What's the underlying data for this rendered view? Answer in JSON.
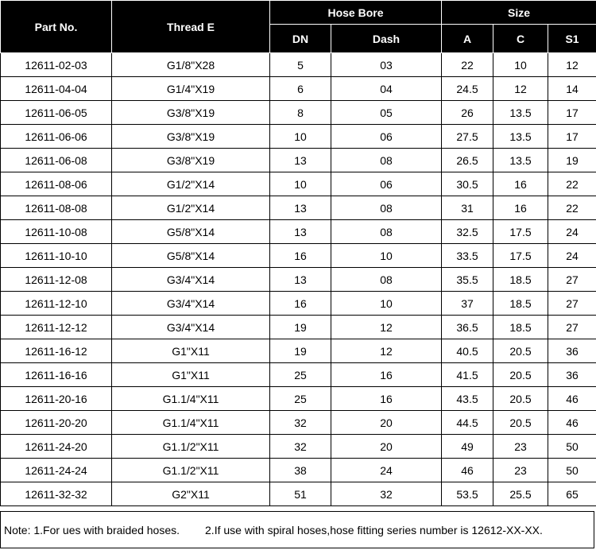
{
  "headers": {
    "part_no": "Part No.",
    "thread": "Thread E",
    "hose_bore": "Hose Bore",
    "size": "Size",
    "dn": "DN",
    "dash": "Dash",
    "a": "A",
    "c": "C",
    "s1": "S1"
  },
  "rows": [
    [
      "12611-02-03",
      "G1/8\"X28",
      "5",
      "03",
      "22",
      "10",
      "12"
    ],
    [
      "12611-04-04",
      "G1/4\"X19",
      "6",
      "04",
      "24.5",
      "12",
      "14"
    ],
    [
      "12611-06-05",
      "G3/8\"X19",
      "8",
      "05",
      "26",
      "13.5",
      "17"
    ],
    [
      "12611-06-06",
      "G3/8\"X19",
      "10",
      "06",
      "27.5",
      "13.5",
      "17"
    ],
    [
      "12611-06-08",
      "G3/8\"X19",
      "13",
      "08",
      "26.5",
      "13.5",
      "19"
    ],
    [
      "12611-08-06",
      "G1/2\"X14",
      "10",
      "06",
      "30.5",
      "16",
      "22"
    ],
    [
      "12611-08-08",
      "G1/2\"X14",
      "13",
      "08",
      "31",
      "16",
      "22"
    ],
    [
      "12611-10-08",
      "G5/8\"X14",
      "13",
      "08",
      "32.5",
      "17.5",
      "24"
    ],
    [
      "12611-10-10",
      "G5/8\"X14",
      "16",
      "10",
      "33.5",
      "17.5",
      "24"
    ],
    [
      "12611-12-08",
      "G3/4\"X14",
      "13",
      "08",
      "35.5",
      "18.5",
      "27"
    ],
    [
      "12611-12-10",
      "G3/4\"X14",
      "16",
      "10",
      "37",
      "18.5",
      "27"
    ],
    [
      "12611-12-12",
      "G3/4\"X14",
      "19",
      "12",
      "36.5",
      "18.5",
      "27"
    ],
    [
      "12611-16-12",
      "G1\"X11",
      "19",
      "12",
      "40.5",
      "20.5",
      "36"
    ],
    [
      "12611-16-16",
      "G1\"X11",
      "25",
      "16",
      "41.5",
      "20.5",
      "36"
    ],
    [
      "12611-20-16",
      "G1.1/4\"X11",
      "25",
      "16",
      "43.5",
      "20.5",
      "46"
    ],
    [
      "12611-20-20",
      "G1.1/4\"X11",
      "32",
      "20",
      "44.5",
      "20.5",
      "46"
    ],
    [
      "12611-24-20",
      "G1.1/2\"X11",
      "32",
      "20",
      "49",
      "23",
      "50"
    ],
    [
      "12611-24-24",
      "G1.1/2\"X11",
      "38",
      "24",
      "46",
      "23",
      "50"
    ],
    [
      "12611-32-32",
      "G2\"X11",
      "51",
      "32",
      "53.5",
      "25.5",
      "65"
    ]
  ],
  "note": {
    "part1": "Note: 1.For ues with braided hoses.",
    "part2": "2.If use with spiral hoses,hose fitting series number is 12612-XX-XX."
  }
}
